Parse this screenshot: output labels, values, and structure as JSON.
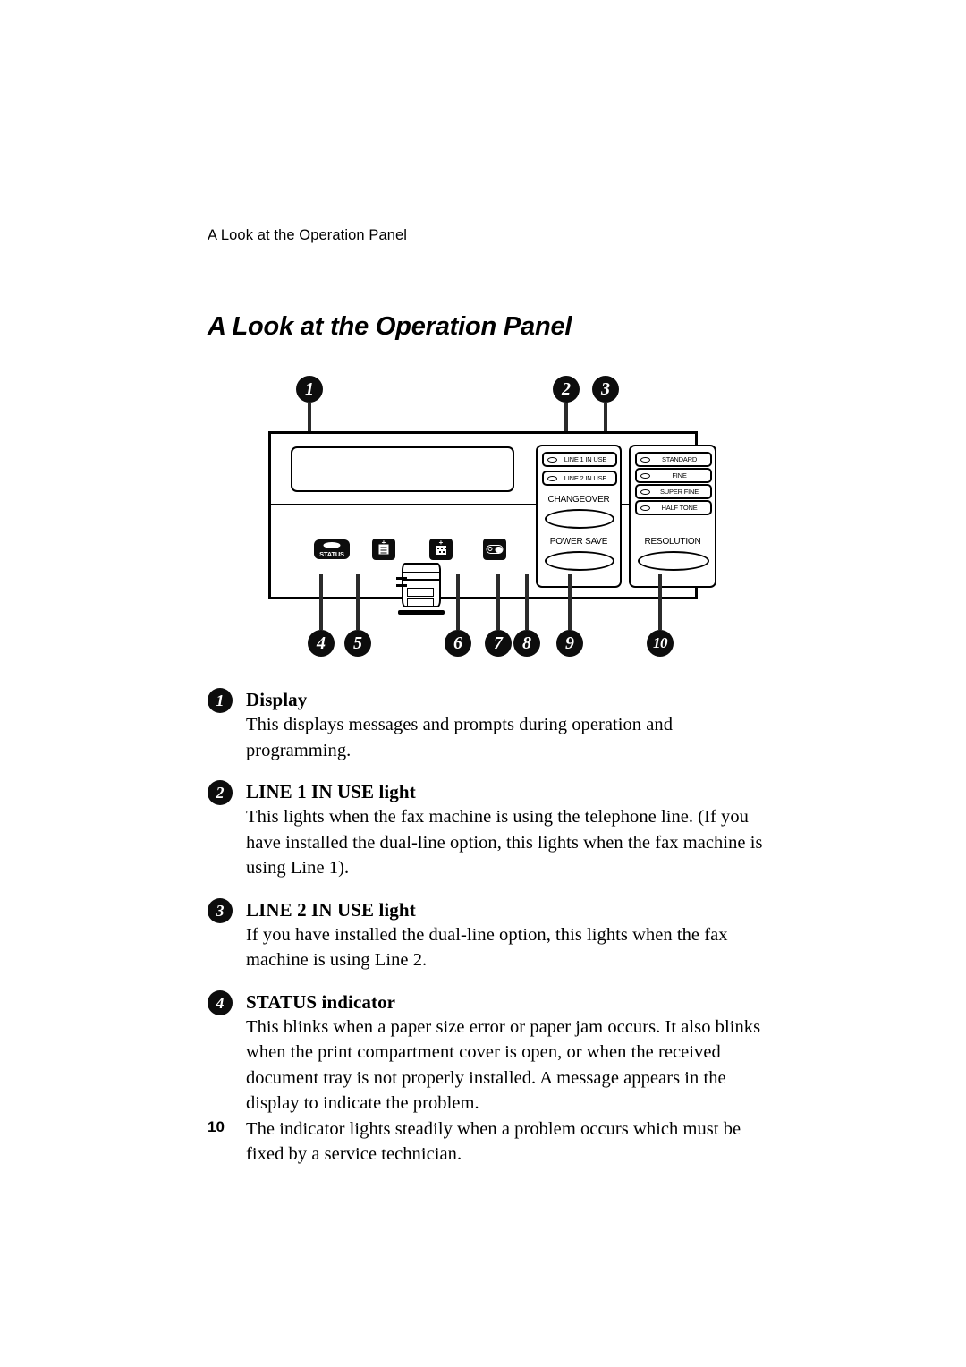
{
  "document": {
    "running_header": "A Look at the Operation Panel",
    "title": "A Look at the Operation Panel",
    "page_number": "10"
  },
  "figure": {
    "callouts_top": [
      {
        "number": "1"
      },
      {
        "number": "2"
      },
      {
        "number": "3"
      }
    ],
    "callouts_bottom": [
      {
        "number": "4"
      },
      {
        "number": "5"
      },
      {
        "number": "6"
      },
      {
        "number": "7"
      },
      {
        "number": "8"
      },
      {
        "number": "9"
      },
      {
        "number": "10"
      }
    ],
    "panel": {
      "status_key_label": "STATUS",
      "line_buttons": [
        {
          "label": "LINE 1 IN USE"
        },
        {
          "label": "LINE 2 IN USE"
        }
      ],
      "changeover_label": "CHANGEOVER",
      "power_save_label": "POWER SAVE",
      "resolution_buttons": [
        {
          "label": "STANDARD"
        },
        {
          "label": "FINE"
        },
        {
          "label": "SUPER FINE"
        },
        {
          "label": "HALF TONE"
        }
      ],
      "resolution_label": "RESOLUTION"
    }
  },
  "descriptions": [
    {
      "number": "1",
      "heading": "Display",
      "paragraphs": [
        "This displays messages and prompts during operation and programming."
      ]
    },
    {
      "number": "2",
      "heading": "LINE 1 IN USE light",
      "paragraphs": [
        "This lights when the fax machine is using the telephone line. (If you have installed the dual-line option, this lights when the fax machine is using Line 1)."
      ]
    },
    {
      "number": "3",
      "heading": "LINE 2 IN USE light",
      "paragraphs": [
        "If you have installed the dual-line option, this lights when the fax machine is using Line 2."
      ]
    },
    {
      "number": "4",
      "heading": "STATUS indicator",
      "paragraphs": [
        "This blinks when a paper size error or paper jam occurs. It also blinks when the print compartment cover is open, or when the received document tray is not properly installed. A message appears in the display to indicate the problem.",
        "The indicator lights steadily when a problem occurs which must be fixed by a service technician."
      ]
    }
  ]
}
